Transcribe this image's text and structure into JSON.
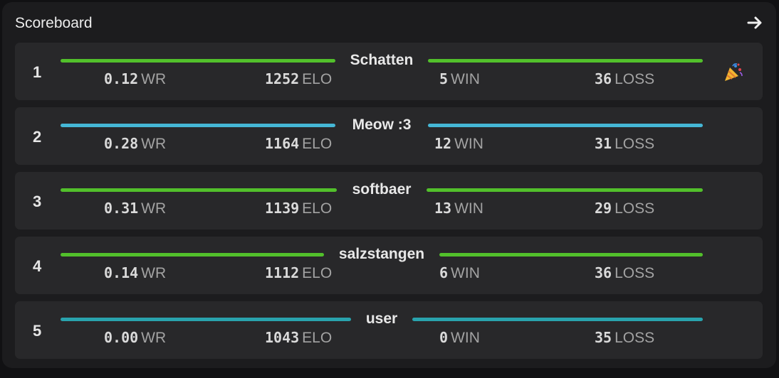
{
  "header": {
    "title": "Scoreboard"
  },
  "icons": {
    "arrow": "arrow-right-icon",
    "celebration": "party-popper-icon"
  },
  "colors": {
    "green": "#52c02b",
    "blue": "#45b7d6",
    "teal": "#29a3ad"
  },
  "labels": {
    "wr": "WR",
    "elo": "ELO",
    "win": "WIN",
    "loss": "LOSS"
  },
  "rows": [
    {
      "rank": "1",
      "name": "Schatten",
      "wr": "0.12",
      "elo": "1252",
      "win": "5",
      "loss": "36",
      "color": "#52c02b"
    },
    {
      "rank": "2",
      "name": "Meow :3",
      "wr": "0.28",
      "elo": "1164",
      "win": "12",
      "loss": "31",
      "color": "#45b7d6"
    },
    {
      "rank": "3",
      "name": "softbaer",
      "wr": "0.31",
      "elo": "1139",
      "win": "13",
      "loss": "29",
      "color": "#52c02b"
    },
    {
      "rank": "4",
      "name": "salzstangen",
      "wr": "0.14",
      "elo": "1112",
      "win": "6",
      "loss": "36",
      "color": "#52c02b"
    },
    {
      "rank": "5",
      "name": "user",
      "wr": "0.00",
      "elo": "1043",
      "win": "0",
      "loss": "35",
      "color": "#29a3ad"
    }
  ]
}
